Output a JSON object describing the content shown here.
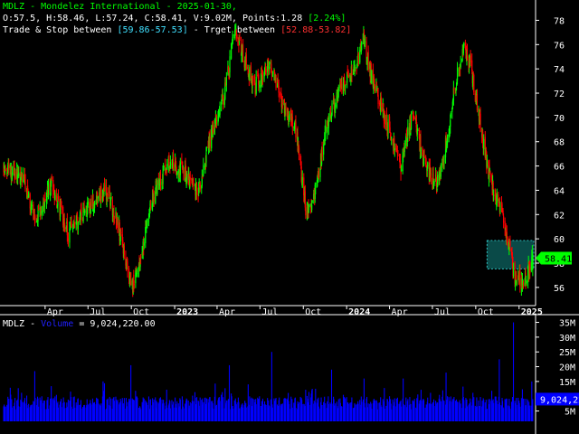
{
  "header": {
    "line1": "MDLZ - Mondelez International - 2025-01-30,",
    "open": "O:57.5",
    "high": "H:58.46",
    "low": "L:57.24",
    "close": "C:58.41",
    "volume": "V:9.02M",
    "points": "Points:1.28",
    "pct": "[2.24%]",
    "trade_label": "Trade & Stop between",
    "trade_range": "[59.86-57.53]",
    "target_label": "- Trget between",
    "target_range": "[52.88-53.82]"
  },
  "volume_panel": {
    "ticker": "MDLZ -",
    "series_name": "Volume",
    "value_text": "= 9,024,220.00",
    "last_value_label": "9,024,22"
  },
  "price_last_label": "58.41",
  "colors": {
    "up": "#00ff00",
    "down": "#ff0000",
    "volume": "#0000ff",
    "zone": "#0a4a48",
    "last_price_bg": "#00ff00"
  },
  "chart_data": [
    {
      "type": "candlestick",
      "x_ticks": [
        "Apr",
        "Jul",
        "Oct",
        "2023",
        "Apr",
        "Jul",
        "Oct",
        "2024",
        "Apr",
        "Jul",
        "Oct",
        "2025"
      ],
      "y_ticks": [
        56,
        58,
        60,
        62,
        64,
        66,
        68,
        70,
        72,
        74,
        76,
        78
      ],
      "ylim": [
        54.5,
        79.3
      ],
      "last_close": 58.41,
      "zone": {
        "low": 57.53,
        "high": 59.86,
        "start": "2024-10-25"
      },
      "price_path": [
        [
          "2022-01-03",
          66.0
        ],
        [
          "2022-02-15",
          65.0
        ],
        [
          "2022-03-08",
          61.5
        ],
        [
          "2022-04-15",
          64.5
        ],
        [
          "2022-05-20",
          60.5
        ],
        [
          "2022-07-01",
          62.5
        ],
        [
          "2022-08-10",
          64.0
        ],
        [
          "2022-09-10",
          60.0
        ],
        [
          "2022-10-03",
          56.0
        ],
        [
          "2022-10-18",
          58.0
        ],
        [
          "2022-11-15",
          63.5
        ],
        [
          "2022-12-20",
          66.5
        ],
        [
          "2023-01-20",
          65.5
        ],
        [
          "2023-02-20",
          63.8
        ],
        [
          "2023-03-15",
          68.0
        ],
        [
          "2023-04-20",
          72.5
        ],
        [
          "2023-05-08",
          77.0
        ],
        [
          "2023-06-01",
          74.5
        ],
        [
          "2023-06-20",
          72.5
        ],
        [
          "2023-07-20",
          74.5
        ],
        [
          "2023-08-20",
          71.0
        ],
        [
          "2023-09-15",
          69.0
        ],
        [
          "2023-10-08",
          62.0
        ],
        [
          "2023-10-27",
          64.0
        ],
        [
          "2023-11-20",
          69.5
        ],
        [
          "2023-12-20",
          72.5
        ],
        [
          "2024-01-20",
          74.0
        ],
        [
          "2024-02-05",
          76.5
        ],
        [
          "2024-02-25",
          73.0
        ],
        [
          "2024-03-15",
          71.0
        ],
        [
          "2024-04-08",
          68.0
        ],
        [
          "2024-04-25",
          66.0
        ],
        [
          "2024-05-20",
          70.5
        ],
        [
          "2024-06-15",
          66.0
        ],
        [
          "2024-07-10",
          64.5
        ],
        [
          "2024-07-31",
          68.0
        ],
        [
          "2024-08-20",
          73.0
        ],
        [
          "2024-09-05",
          75.5
        ],
        [
          "2024-09-20",
          74.5
        ],
        [
          "2024-10-08",
          70.0
        ],
        [
          "2024-10-25",
          66.0
        ],
        [
          "2024-11-08",
          64.0
        ],
        [
          "2024-11-25",
          62.0
        ],
        [
          "2024-12-10",
          59.5
        ],
        [
          "2024-12-22",
          57.0
        ],
        [
          "2025-01-10",
          56.5
        ],
        [
          "2025-01-30",
          58.41
        ]
      ]
    },
    {
      "type": "bar",
      "series": [
        {
          "name": "Volume",
          "last_value": 9024220
        }
      ],
      "y_ticks": [
        "5M",
        "10M",
        "15M",
        "20M",
        "25M",
        "30M",
        "35M"
      ],
      "y_tick_values": [
        5000000,
        10000000,
        15000000,
        20000000,
        25000000,
        30000000,
        35000000
      ],
      "ylim": [
        1500000,
        37000000
      ],
      "spikes": [
        [
          "2022-03-10",
          18500000
        ],
        [
          "2022-09-30",
          20500000
        ],
        [
          "2023-04-27",
          20500000
        ],
        [
          "2023-07-26",
          25000000
        ],
        [
          "2023-11-30",
          19000000
        ],
        [
          "2024-02-07",
          16000000
        ],
        [
          "2024-04-30",
          16000000
        ],
        [
          "2024-07-30",
          18000000
        ],
        [
          "2024-11-20",
          22500000
        ],
        [
          "2024-12-20",
          35000000
        ],
        [
          "2025-01-28",
          15000000
        ]
      ]
    }
  ]
}
